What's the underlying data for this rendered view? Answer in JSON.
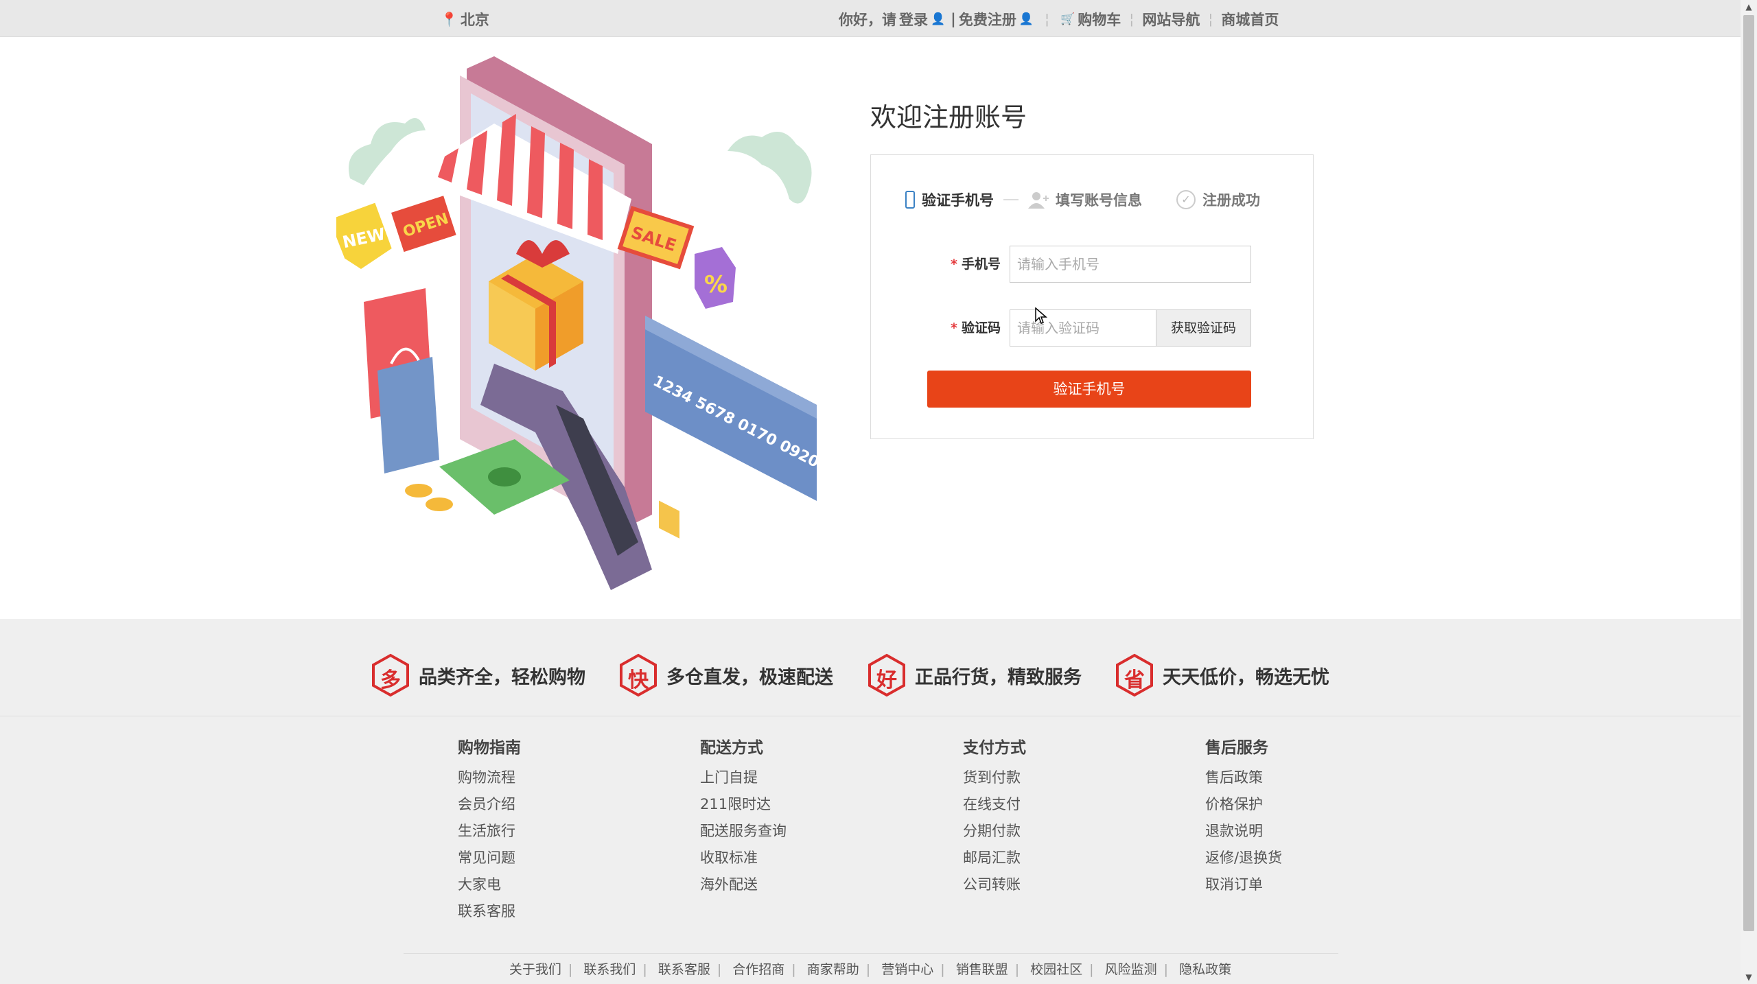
{
  "topbar": {
    "location": "北京",
    "greeting": "你好，请",
    "login": "登录",
    "register": "免费注册",
    "cart": "购物车",
    "site_nav": "网站导航",
    "mall_home": "商城首页"
  },
  "register": {
    "title": "欢迎注册账号",
    "steps": [
      "验证手机号",
      "填写账号信息",
      "注册成功"
    ],
    "phone_label": "手机号",
    "phone_placeholder": "请输入手机号",
    "code_label": "验证码",
    "code_placeholder": "请输入验证码",
    "get_code": "获取验证码",
    "submit": "验证手机号"
  },
  "illustration": {
    "texts": [
      "NEW",
      "OPEN",
      "SALE",
      "%",
      "1234 5678 0170 0920"
    ]
  },
  "features": [
    {
      "icon": "多",
      "text": "品类齐全，轻松购物"
    },
    {
      "icon": "快",
      "text": "多仓直发，极速配送"
    },
    {
      "icon": "好",
      "text": "正品行货，精致服务"
    },
    {
      "icon": "省",
      "text": "天天低价，畅选无忧"
    }
  ],
  "footer_columns": [
    {
      "title": "购物指南",
      "links": [
        "购物流程",
        "会员介绍",
        "生活旅行",
        "常见问题",
        "大家电",
        "联系客服"
      ]
    },
    {
      "title": "配送方式",
      "links": [
        "上门自提",
        "211限时达",
        "配送服务查询",
        "收取标准",
        "海外配送"
      ]
    },
    {
      "title": "支付方式",
      "links": [
        "货到付款",
        "在线支付",
        "分期付款",
        "邮局汇款",
        "公司转账"
      ]
    },
    {
      "title": "售后服务",
      "links": [
        "售后政策",
        "价格保护",
        "退款说明",
        "返修/退换货",
        "取消订单"
      ]
    }
  ],
  "bottom_links": [
    "关于我们",
    "联系我们",
    "联系客服",
    "合作招商",
    "商家帮助",
    "营销中心",
    "销售联盟",
    "校园社区",
    "风险监测",
    "隐私政策"
  ],
  "colors": {
    "accent": "#e84418",
    "brand_red": "#e4393c",
    "step_blue": "#3b82c4"
  }
}
